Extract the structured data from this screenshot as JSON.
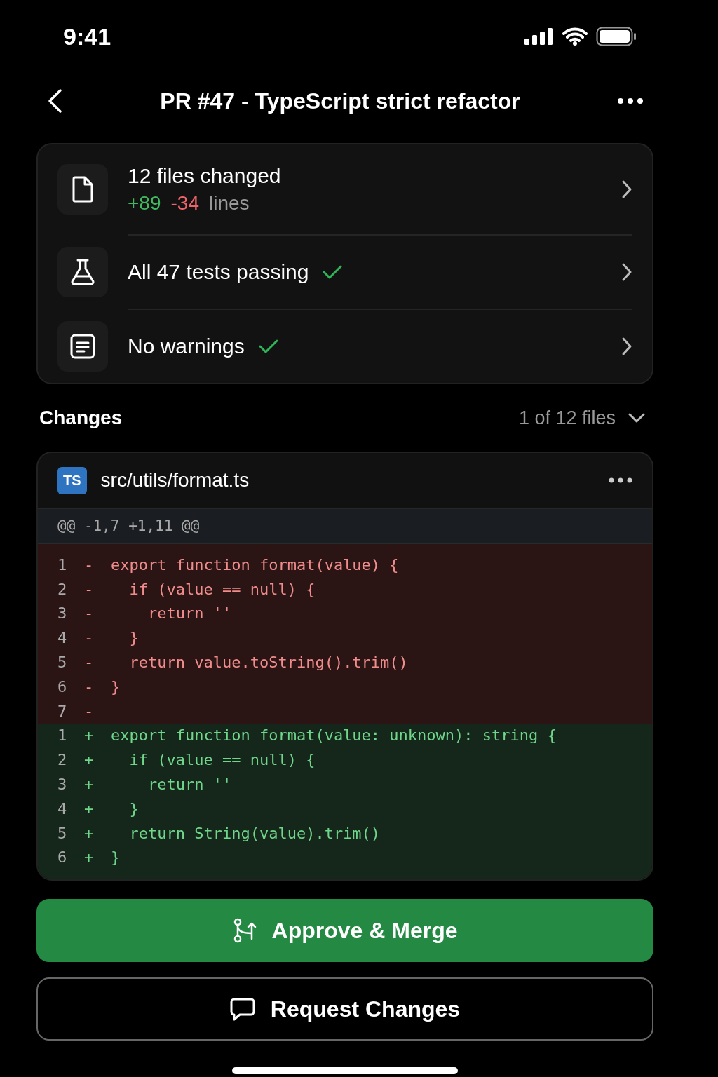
{
  "status_bar": {
    "time": "9:41"
  },
  "nav": {
    "title": "PR #47 - TypeScript strict refactor"
  },
  "summary": [
    {
      "kind": "file",
      "title": "12 files changed",
      "added": "+89",
      "removed": "-34",
      "suffix": "lines"
    },
    {
      "kind": "flask",
      "title": "All 47 tests passing",
      "ok": true
    },
    {
      "kind": "list",
      "title": "No warnings",
      "ok": true
    }
  ],
  "changes": {
    "title": "Changes",
    "count": "1 of 12 files"
  },
  "file": {
    "badge": "TS",
    "path": "src/utils/format.ts",
    "hunk": "@@ -1,7 +1,11 @@",
    "lines": [
      {
        "kind": "removed",
        "num": "1",
        "sign": "-",
        "code": "export function format(value) {"
      },
      {
        "kind": "removed",
        "num": "2",
        "sign": "-",
        "code": "  if (value == null) {"
      },
      {
        "kind": "removed",
        "num": "3",
        "sign": "-",
        "code": "    return ''"
      },
      {
        "kind": "removed",
        "num": "4",
        "sign": "-",
        "code": "  }"
      },
      {
        "kind": "removed",
        "num": "5",
        "sign": "-",
        "code": "  return value.toString().trim()"
      },
      {
        "kind": "removed",
        "num": "6",
        "sign": "-",
        "code": "}"
      },
      {
        "kind": "removed",
        "num": "7",
        "sign": "-"
      },
      {
        "kind": "added",
        "num": "1",
        "sign": "+",
        "code": "export function format(value: unknown): string {"
      },
      {
        "kind": "added",
        "num": "2",
        "sign": "+",
        "code": "  if (value == null) {"
      },
      {
        "kind": "added",
        "num": "3",
        "sign": "+",
        "code": "    return ''"
      },
      {
        "kind": "added",
        "num": "4",
        "sign": "+",
        "code": "  }"
      },
      {
        "kind": "added",
        "num": "5",
        "sign": "+",
        "code": "  return String(value).trim()"
      },
      {
        "kind": "added",
        "num": "6",
        "sign": "+",
        "code": "}"
      }
    ]
  },
  "actions": [
    {
      "kind": "primary",
      "label": "Approve & Merge"
    },
    {
      "kind": "secondary",
      "label": "Request Changes"
    }
  ]
}
